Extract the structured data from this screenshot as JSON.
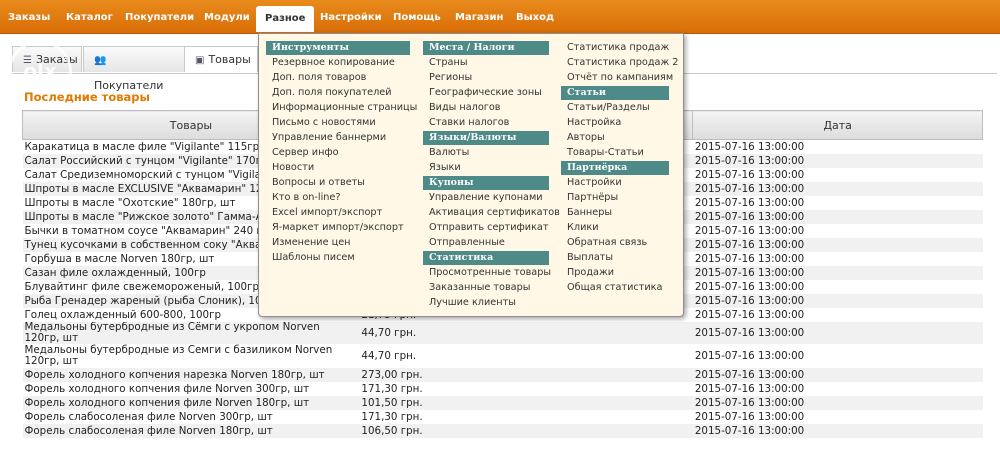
{
  "nav": {
    "items": [
      "Заказы",
      "Каталог",
      "Покупатели",
      "Модули",
      "Разное",
      "Настройки",
      "Помощь",
      "Магазин",
      "Выход"
    ],
    "active": "Разное"
  },
  "tabs": [
    {
      "label": "Заказы",
      "icon": "orders-icon"
    },
    {
      "label": "Покупатели",
      "icon": "users-icon"
    },
    {
      "label": "Товары",
      "icon": "products-icon"
    }
  ],
  "section_title": "Последние товары",
  "table": {
    "headers": [
      "Товары",
      "",
      "Дата"
    ],
    "rows": [
      [
        "Каракатица в масле филе \"Vigilante\" 115гр, шт",
        "",
        "2015-07-16 13:00:00"
      ],
      [
        "Салат Российский с тунцом \"Vigilante\" 170гр, шт",
        "",
        "2015-07-16 13:00:00"
      ],
      [
        "Салат Средиземноморский с тунцом \"Vigilante\"",
        "",
        "2015-07-16 13:00:00"
      ],
      [
        "Шпроты в масле EXCLUSIVE \"Аквамарин\" 12",
        "",
        "2015-07-16 13:00:00"
      ],
      [
        "Шпроты в масле \"Охотские\" 180гр, шт",
        "",
        "2015-07-16 13:00:00"
      ],
      [
        "Шпроты в масле \"Рижское золото\" Гамма-А 1",
        "",
        "2015-07-16 13:00:00"
      ],
      [
        "Бычки в томатном соусе \"Аквамарин\" 240 гр",
        "",
        "2015-07-16 13:00:00"
      ],
      [
        "Тунец кусочками в собственном соку \"Аквамар",
        "",
        "2015-07-16 13:00:00"
      ],
      [
        "Горбуша в масле Norven 180гр, шт",
        "",
        "2015-07-16 13:00:00"
      ],
      [
        "Сазан филе охлажденный, 100гр",
        "",
        "2015-07-16 13:00:00"
      ],
      [
        "Блувайтинг филе свежемороженый, 100гр",
        "",
        "2015-07-16 13:00:00"
      ],
      [
        "Рыба Гренадер жареный (рыба Слоник), 100г",
        "",
        "2015-07-16 13:00:00"
      ],
      [
        "Голец охлажденный 600-800, 100гр",
        "21,75 грн.",
        "2015-07-16 13:00:00"
      ],
      [
        "Медальоны бутербродные из Сёмги с укропом Norven 120гр, шт",
        "44,70 грн.",
        "2015-07-16 13:00:00"
      ],
      [
        "Медальоны бутербродные из Семги с базиликом Norven 120гр, шт",
        "44,70 грн.",
        "2015-07-16 13:00:00"
      ],
      [
        "Форель холодного копчения нарезка Norven 180гр, шт",
        "273,00 грн.",
        "2015-07-16 13:00:00"
      ],
      [
        "Форель холодного копчения филе Norven 300гр, шт",
        "171,30 грн.",
        "2015-07-16 13:00:00"
      ],
      [
        "Форель холодного копчения филе Norven 180гр, шт",
        "101,50 грн.",
        "2015-07-16 13:00:00"
      ],
      [
        "Форель слабосоленая филе Norven 300гр, шт",
        "171,30 грн.",
        "2015-07-16 13:00:00"
      ],
      [
        "Форель слабосоленая филе Norven 180гр, шт",
        "106,50 грн.",
        "2015-07-16 13:00:00"
      ]
    ]
  },
  "dropdown": {
    "col1": [
      {
        "t": "h",
        "label": "Инструменты"
      },
      {
        "t": "i",
        "label": "Резервное копирование"
      },
      {
        "t": "i",
        "label": "Доп. поля товаров"
      },
      {
        "t": "i",
        "label": "Доп. поля покупателей"
      },
      {
        "t": "i",
        "label": "Информационные страницы"
      },
      {
        "t": "i",
        "label": "Письмо с новостями"
      },
      {
        "t": "i",
        "label": "Управление баннерми"
      },
      {
        "t": "i",
        "label": "Сервер инфо"
      },
      {
        "t": "i",
        "label": "Новости"
      },
      {
        "t": "i",
        "label": "Вопросы и ответы"
      },
      {
        "t": "i",
        "label": "Кто в on-line?"
      },
      {
        "t": "i",
        "label": "Excel импорт/экспорт"
      },
      {
        "t": "i",
        "label": "Я-маркет импорт/экспорт"
      },
      {
        "t": "i",
        "label": "Изменение цен"
      },
      {
        "t": "i",
        "label": "Шаблоны писем"
      }
    ],
    "col2": [
      {
        "t": "h",
        "label": "Места / Налоги"
      },
      {
        "t": "i",
        "label": "Страны"
      },
      {
        "t": "i",
        "label": "Регионы"
      },
      {
        "t": "i",
        "label": "Географические зоны"
      },
      {
        "t": "i",
        "label": "Виды налогов"
      },
      {
        "t": "i",
        "label": "Ставки налогов"
      },
      {
        "t": "h",
        "label": "Языки/Валюты"
      },
      {
        "t": "i",
        "label": "Валюты"
      },
      {
        "t": "i",
        "label": "Языки"
      },
      {
        "t": "h",
        "label": "Купоны"
      },
      {
        "t": "i",
        "label": "Управление купонами"
      },
      {
        "t": "i",
        "label": "Активация сертификатов"
      },
      {
        "t": "i",
        "label": "Отправить сертификат"
      },
      {
        "t": "i",
        "label": "Отправленные"
      },
      {
        "t": "h",
        "label": "Статистика"
      },
      {
        "t": "i",
        "label": "Просмотренные товары"
      },
      {
        "t": "i",
        "label": "Заказанные товары"
      },
      {
        "t": "i",
        "label": "Лучшие клиенты"
      }
    ],
    "col3": [
      {
        "t": "i",
        "label": "Статистика продаж"
      },
      {
        "t": "i",
        "label": "Статистика продаж 2"
      },
      {
        "t": "i",
        "label": "Отчёт по кампаниям"
      },
      {
        "t": "h",
        "label": "Статьи"
      },
      {
        "t": "i",
        "label": "Статьи/Разделы"
      },
      {
        "t": "i",
        "label": "Настройка"
      },
      {
        "t": "i",
        "label": "Авторы"
      },
      {
        "t": "i",
        "label": "Товары-Статьи"
      },
      {
        "t": "h",
        "label": "Партнёрка"
      },
      {
        "t": "i",
        "label": "Настройки"
      },
      {
        "t": "i",
        "label": "Партнёры"
      },
      {
        "t": "i",
        "label": "Баннеры"
      },
      {
        "t": "i",
        "label": "Клики"
      },
      {
        "t": "i",
        "label": "Обратная связь"
      },
      {
        "t": "i",
        "label": "Выплаты"
      },
      {
        "t": "i",
        "label": "Продажи"
      },
      {
        "t": "i",
        "label": "Общая статистика"
      }
    ]
  },
  "watermark": "olx"
}
